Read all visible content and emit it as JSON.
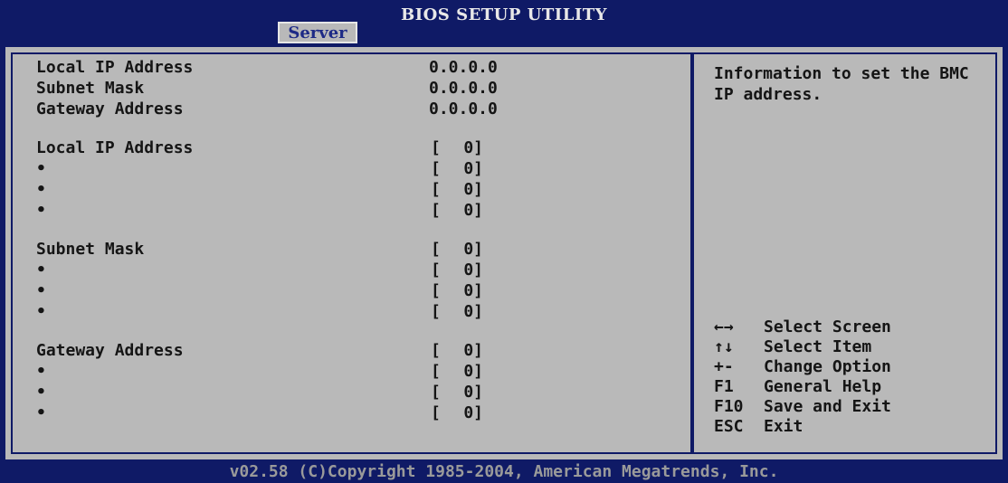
{
  "app": {
    "title": "BIOS SETUP UTILITY",
    "active_tab": "Server"
  },
  "status": [
    {
      "label": "Local IP Address",
      "value": "0.0.0.0"
    },
    {
      "label": "Subnet Mask",
      "value": "0.0.0.0"
    },
    {
      "label": "Gateway Address",
      "value": "0.0.0.0"
    }
  ],
  "bracket": {
    "open": "[",
    "close": "0]"
  },
  "groups": [
    {
      "label": "Local IP Address",
      "bullet": "•"
    },
    {
      "label": "Subnet Mask",
      "bullet": "•"
    },
    {
      "label": "Gateway Address",
      "bullet": "•"
    }
  ],
  "help": {
    "text": "Information to set the BMC IP address."
  },
  "keys": [
    {
      "key": "←→",
      "desc": "Select Screen"
    },
    {
      "key": "↑↓",
      "desc": "Select Item"
    },
    {
      "key": "+-",
      "desc": "Change Option"
    },
    {
      "key": "F1",
      "desc": "General Help"
    },
    {
      "key": "F10",
      "desc": "Save and Exit"
    },
    {
      "key": "ESC",
      "desc": "Exit"
    }
  ],
  "footer": {
    "text": "v02.58 (C)Copyright 1985-2004, American Megatrends, Inc."
  },
  "colors": {
    "frame": "#0f1a66",
    "panel": "#b9b9b9",
    "tab_text": "#1d2a86"
  }
}
